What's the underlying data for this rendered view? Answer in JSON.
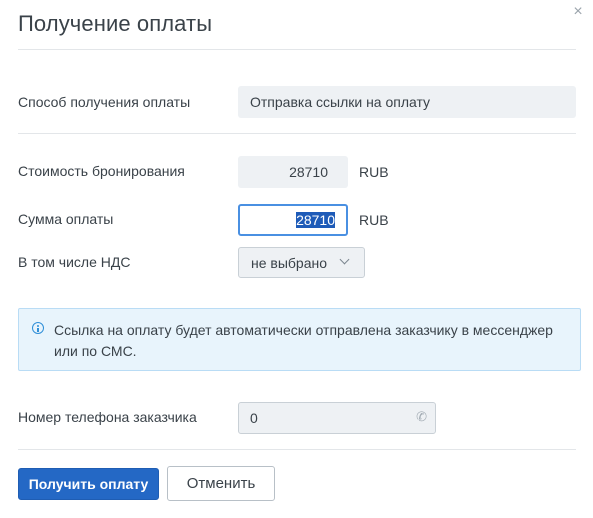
{
  "dialog": {
    "title": "Получение оплаты",
    "close_icon": "close-icon"
  },
  "payment_method": {
    "label": "Способ получения оплаты",
    "value": "Отправка ссылки на оплату"
  },
  "booking_cost": {
    "label": "Стоимость бронирования",
    "value": "28710",
    "currency": "RUB"
  },
  "payment_amount": {
    "label": "Сумма оплаты",
    "value": "28710",
    "currency": "RUB",
    "text_selected": true
  },
  "vat": {
    "label": "В том числе НДС",
    "selected": "не выбрано",
    "chevron_icon": "chevron-down-icon"
  },
  "info": {
    "icon": "info-icon",
    "text": "Ссылка на оплату будет автоматически отправлена заказчику в мессенджер или по СМС."
  },
  "phone": {
    "label": "Номер телефона заказчика",
    "value": "0",
    "icon": "phone-icon"
  },
  "actions": {
    "submit_label": "Получить оплату",
    "cancel_label": "Отменить"
  },
  "colors": {
    "primary": "#2468c5",
    "focus_border": "#4a90e2",
    "info_bg": "#e8f4fc",
    "info_border": "#b9dcf5",
    "info_icon": "#2f8fd8",
    "field_bg": "#eef1f4"
  }
}
